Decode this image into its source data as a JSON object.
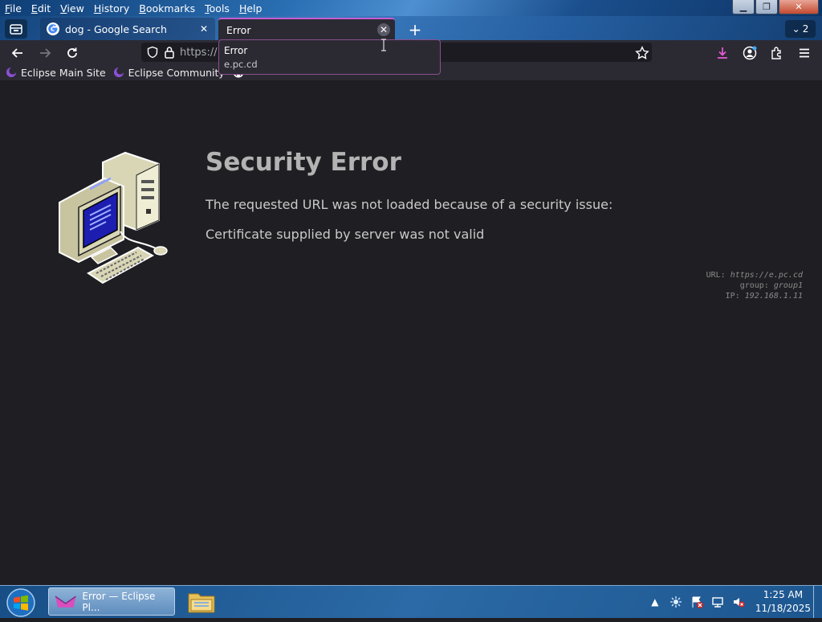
{
  "menu": {
    "items": [
      {
        "u": "F",
        "rest": "ile"
      },
      {
        "u": "E",
        "rest": "dit"
      },
      {
        "u": "V",
        "rest": "iew"
      },
      {
        "u": "H",
        "rest": "istory"
      },
      {
        "u": "B",
        "rest": "ookmarks"
      },
      {
        "u": "T",
        "rest": "ools"
      },
      {
        "u": "H",
        "rest": "elp"
      }
    ]
  },
  "tabs": {
    "inactive_title": "dog - Google Search",
    "active_title": "Error",
    "count": "2"
  },
  "urlbar": {
    "value": "https://"
  },
  "bookmarks": {
    "items": [
      "Eclipse Main Site",
      "Eclipse Community"
    ]
  },
  "tooltip": {
    "title": "Error",
    "url": "e.pc.cd"
  },
  "page": {
    "title": "Security Error",
    "line1": "The requested URL was not loaded because of a security issue:",
    "line2": "Certificate supplied by server was not valid",
    "meta": {
      "url_label": "URL:",
      "url_value": "https://e.pc.cd",
      "group_label": "group:",
      "group_value": "group1",
      "ip_label": "IP:",
      "ip_value": "192.168.1.11"
    }
  },
  "taskbar": {
    "active_item": "Error — Eclipse Pl...",
    "time": "1:25 AM",
    "date": "11/18/2025"
  },
  "colors": {
    "accent": "#c85bd1",
    "page_bg": "#1f1e22",
    "toolbar_bg": "#2b2a33"
  }
}
